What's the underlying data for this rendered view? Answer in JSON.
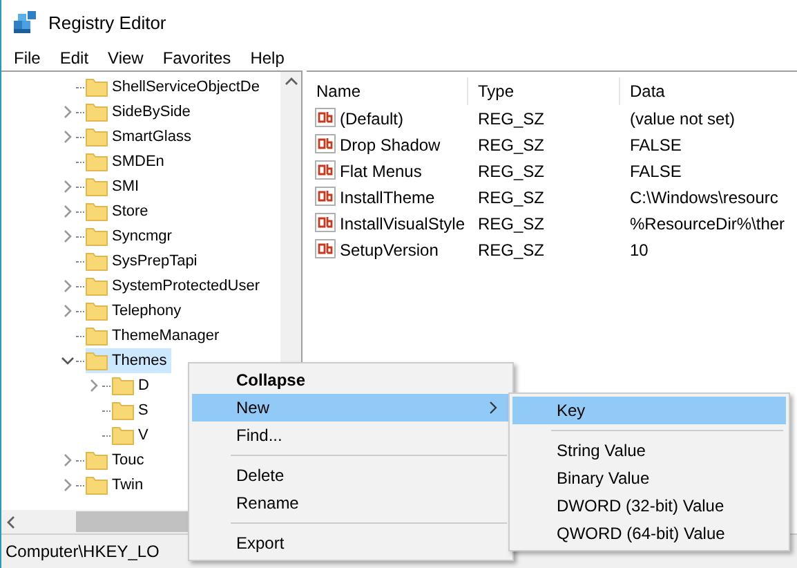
{
  "window": {
    "title": "Registry Editor"
  },
  "menu_bar": [
    "File",
    "Edit",
    "View",
    "Favorites",
    "Help"
  ],
  "tree": [
    {
      "label": "ShellServiceObjectDe",
      "kind": "leaf",
      "selected": false
    },
    {
      "label": "SideBySide",
      "kind": "collapsed",
      "selected": false
    },
    {
      "label": "SmartGlass",
      "kind": "collapsed",
      "selected": false
    },
    {
      "label": "SMDEn",
      "kind": "leaf",
      "selected": false
    },
    {
      "label": "SMI",
      "kind": "collapsed",
      "selected": false
    },
    {
      "label": "Store",
      "kind": "collapsed",
      "selected": false
    },
    {
      "label": "Syncmgr",
      "kind": "collapsed",
      "selected": false
    },
    {
      "label": "SysPrepTapi",
      "kind": "leaf",
      "selected": false
    },
    {
      "label": "SystemProtectedUser",
      "kind": "collapsed",
      "selected": false
    },
    {
      "label": "Telephony",
      "kind": "collapsed",
      "selected": false
    },
    {
      "label": "ThemeManager",
      "kind": "leaf",
      "selected": false
    },
    {
      "label": "Themes",
      "kind": "expanded",
      "selected": true,
      "children": [
        {
          "label": "D",
          "kind": "collapsed",
          "selected": false
        },
        {
          "label": "S",
          "kind": "leaf",
          "selected": false
        },
        {
          "label": "V",
          "kind": "leaf",
          "selected": false
        }
      ]
    },
    {
      "label": "Touc",
      "kind": "collapsed",
      "selected": false
    },
    {
      "label": "Twin",
      "kind": "collapsed",
      "selected": false
    }
  ],
  "values": {
    "columns": [
      "Name",
      "Type",
      "Data"
    ],
    "rows": [
      {
        "name": "(Default)",
        "type": "REG_SZ",
        "data": "(value not set)"
      },
      {
        "name": "Drop Shadow",
        "type": "REG_SZ",
        "data": "FALSE"
      },
      {
        "name": "Flat Menus",
        "type": "REG_SZ",
        "data": "FALSE"
      },
      {
        "name": "InstallTheme",
        "type": "REG_SZ",
        "data": "C:\\Windows\\resourc"
      },
      {
        "name": "InstallVisualStyle",
        "type": "REG_SZ",
        "data": "%ResourceDir%\\ther"
      },
      {
        "name": "SetupVersion",
        "type": "REG_SZ",
        "data": "10"
      }
    ]
  },
  "status_bar": "Computer\\HKEY_LO",
  "context_menu": [
    {
      "label": "Collapse",
      "kind": "default",
      "selected": false
    },
    {
      "label": "New",
      "kind": "submenu",
      "selected": true
    },
    {
      "label": "Find...",
      "kind": "item",
      "selected": false
    },
    {
      "kind": "separator"
    },
    {
      "label": "Delete",
      "kind": "item",
      "selected": false
    },
    {
      "label": "Rename",
      "kind": "item",
      "selected": false
    },
    {
      "kind": "separator"
    },
    {
      "label": "Export",
      "kind": "item",
      "selected": false
    }
  ],
  "submenu": [
    {
      "label": "Key",
      "kind": "item",
      "selected": true
    },
    {
      "kind": "separator"
    },
    {
      "label": "String Value",
      "kind": "item",
      "selected": false
    },
    {
      "label": "Binary Value",
      "kind": "item",
      "selected": false
    },
    {
      "label": "DWORD (32-bit) Value",
      "kind": "item",
      "selected": false
    },
    {
      "label": "QWORD (64-bit) Value",
      "kind": "item",
      "selected": false
    }
  ]
}
